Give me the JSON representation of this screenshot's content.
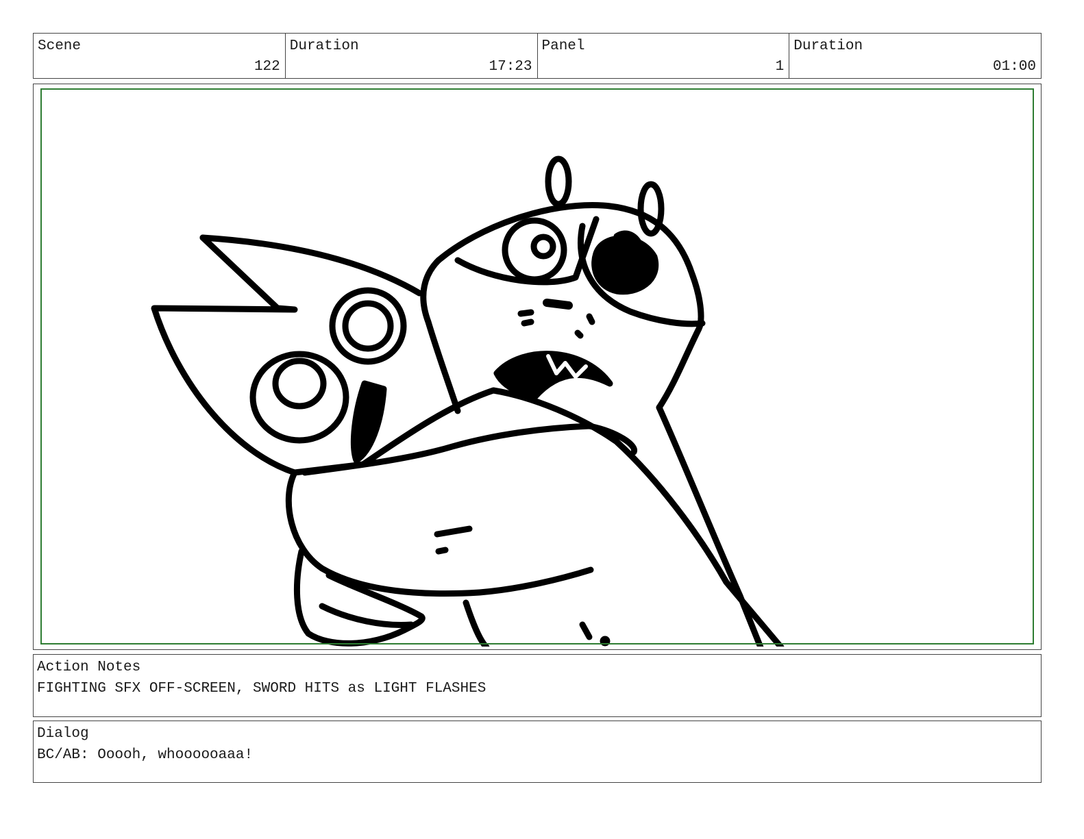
{
  "header": {
    "scene_label": "Scene",
    "scene_value": "122",
    "scene_duration_label": "Duration",
    "scene_duration_value": "17:23",
    "panel_label": "Panel",
    "panel_value": "1",
    "panel_duration_label": "Duration",
    "panel_duration_value": "01:00"
  },
  "panel": {
    "frame_color": "#2e7d32",
    "drawing": "storyboard-sketch"
  },
  "action_notes": {
    "label": "Action Notes",
    "text": "FIGHTING SFX OFF-SCREEN, SWORD HITS as LIGHT FLASHES"
  },
  "dialog": {
    "label": "Dialog",
    "text": "BC/AB: Ooooh, whoooooaaa!"
  }
}
